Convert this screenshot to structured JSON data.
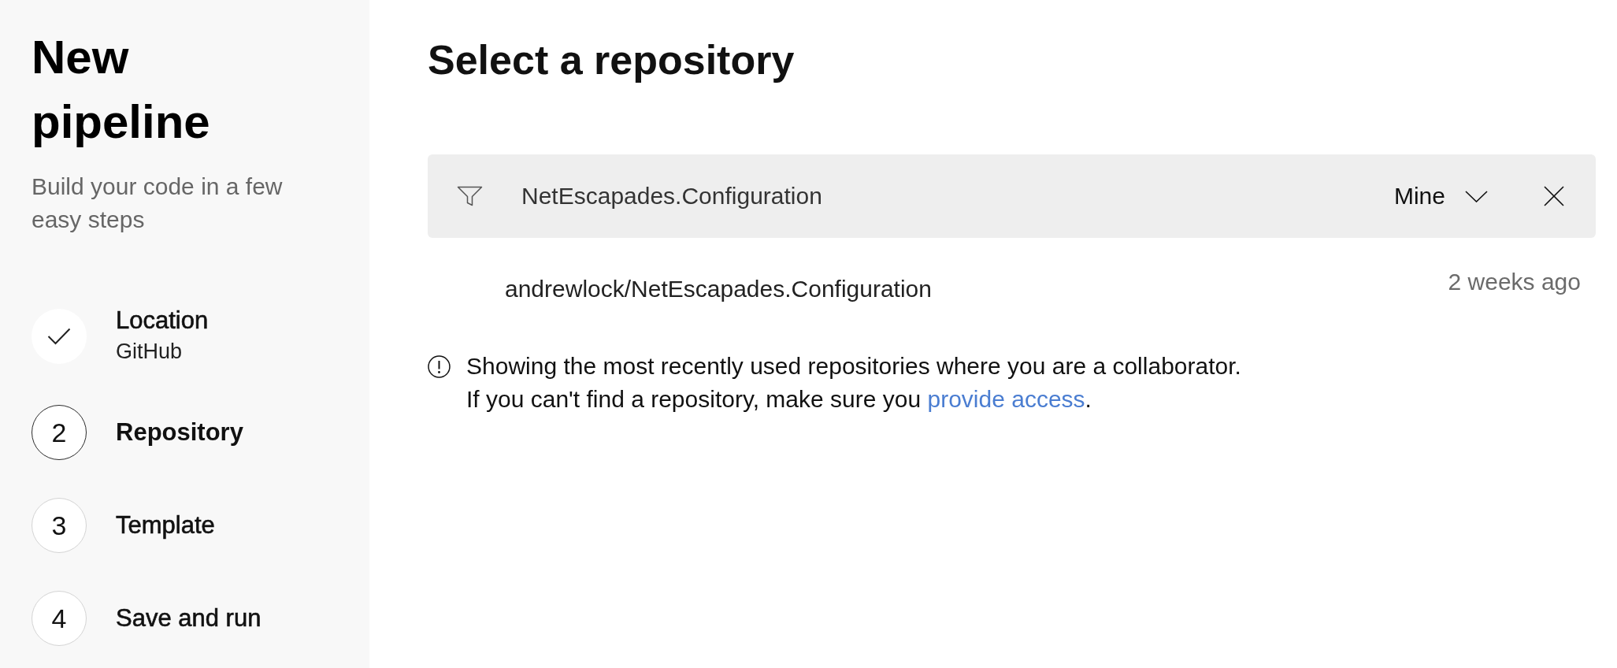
{
  "sidebar": {
    "title": "New pipeline",
    "subtitle": "Build your code in a few easy steps",
    "steps": [
      {
        "label": "Location",
        "detail": "GitHub",
        "completed": true,
        "selected": false
      },
      {
        "number": "2",
        "label": "Repository",
        "completed": false,
        "selected": true
      },
      {
        "number": "3",
        "label": "Template",
        "completed": false,
        "selected": false
      },
      {
        "number": "4",
        "label": "Save and run",
        "completed": false,
        "selected": false
      }
    ]
  },
  "main": {
    "title": "Select a repository",
    "filter": {
      "value": "NetEscapades.Configuration",
      "scope": "Mine"
    },
    "repositories": [
      {
        "name": "andrewlock/NetEscapades.Configuration",
        "updated": "2 weeks ago"
      }
    ],
    "info": {
      "message": "Showing the most recently used repositories where you are a collaborator.",
      "hint": "If you can't find a repository, make sure you",
      "link": "provide access",
      "hint_end": "."
    }
  }
}
